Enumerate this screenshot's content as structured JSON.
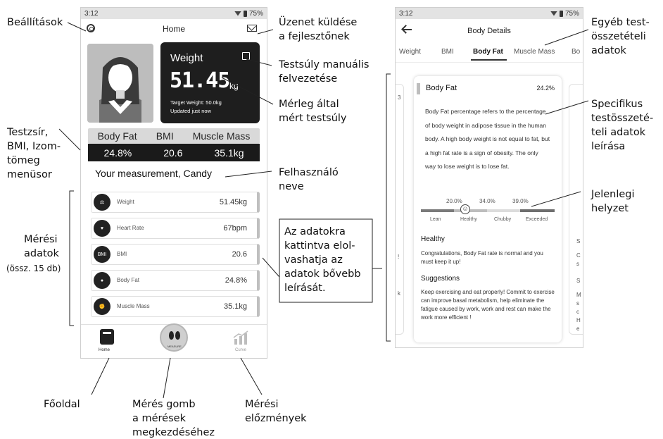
{
  "annotations": {
    "settings": "Beállítások",
    "feedback": "Üzenet küldése\na fejlesztőnek",
    "manual_weight": "Testsúly manuális\nfelvezetése",
    "scale_weight": "Mérleg által\nmért testsúly",
    "menu": "Testzsír,\nBMI, Izom-\ntömeg\nmenüsor",
    "username": "Felhasználó\nneve",
    "measurement_data": "Mérési\nadatok",
    "measurement_count": "(össz. 15 db)",
    "click_info": "Az adatokra\nkattintva elol-\nvashatja az\nadatok bővebb\nleírását.",
    "home": "Főoldal",
    "measure_button": "Mérés gomb\na mérések\nmegkezdéséhez",
    "history": "Mérési\nelőzmények",
    "other_data": "Egyéb test-\nösszetételi\nadatok",
    "specific_description": "Specifikus\ntestösszeté-\nteli adatok\nleírása",
    "current_status": "Jelenlegi\nhelyzet"
  },
  "phone1": {
    "status": {
      "time": "3:12",
      "battery": "75%"
    },
    "header_title": "Home",
    "weight_card": {
      "label": "Weight",
      "value": "51.45",
      "unit": "kg",
      "target": "Target Weight: 50.0kg",
      "updated": "Updated just now"
    },
    "metric_tabs": {
      "labels": [
        "Body Fat",
        "BMI",
        "Muscle Mass"
      ],
      "values": [
        "24.8%",
        "20.6",
        "35.1kg"
      ]
    },
    "greeting": "Your measurement,  Candy",
    "rows": [
      {
        "icon": "scale-icon",
        "name": "Weight",
        "value": "51.45kg"
      },
      {
        "icon": "heart-rate-icon",
        "name": "Heart Rate",
        "value": "67bpm"
      },
      {
        "icon": "bmi-icon",
        "icon_text": "BMI",
        "name": "BMI",
        "value": "20.6"
      },
      {
        "icon": "body-icon",
        "name": "Body Fat",
        "value": "24.8%"
      },
      {
        "icon": "muscle-icon",
        "name": "Muscle Mass",
        "value": "35.1kg"
      }
    ],
    "nav": {
      "home": "Home",
      "measure": "MEASURE",
      "curve": "Curve"
    }
  },
  "phone2": {
    "status": {
      "time": "3:12",
      "battery": "75%"
    },
    "title": "Body Details",
    "tabs": [
      "Weight",
      "BMI",
      "Body Fat",
      "Muscle Mass",
      "Bo"
    ],
    "active_tab": "Body Fat",
    "card": {
      "title": "Body Fat",
      "percent": "24.2%",
      "description": "Body Fat percentage refers to the percentage of body weight in adipose tissue in the human body. A high body weight is not equal to fat, but a high fat rate is a sign of obesity. The only way to lose weight is to lose fat.",
      "thresholds": [
        "20.0%",
        "34.0%",
        "39.0%"
      ],
      "levels": [
        "Lean",
        "Healthy",
        "Chubby",
        "Exceeded"
      ],
      "status": "Healthy",
      "congrats": "Congratulations, Body Fat rate is normal and you must keep it up!",
      "suggestions_title": "Suggestions",
      "suggestions": " Keep exercising and eat properly! Commit to exercise can improve basal metabolism, help eliminate the fatigue caused by work, work and rest can make the work more efficient !"
    },
    "left_card_fragments": [
      "3",
      "!",
      "k"
    ],
    "right_card_fragments": [
      "S",
      "C",
      "s",
      "S",
      "M",
      "s",
      "c",
      "H",
      "e"
    ],
    "accent_colors": {
      "lean": "#7a7a7a",
      "healthy": "#bdbdbd",
      "chubby": "#dcdcdc",
      "exceeded": "#6e6e6e"
    }
  }
}
